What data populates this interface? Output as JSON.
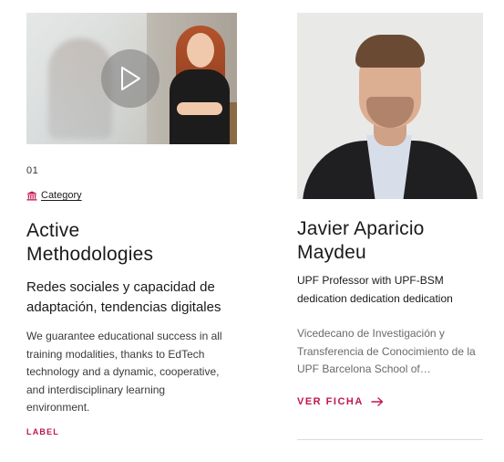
{
  "colors": {
    "accent": "#c0174a",
    "text": "#1a1a1a",
    "muted": "#6a6a6a"
  },
  "left_card": {
    "thumbnail_icon": "play-icon",
    "number": "01",
    "category_icon": "institution-icon",
    "category": "Category",
    "title_line1": "Active",
    "title_line2": "Methodologies",
    "subtitle": "Redes sociales y capacidad de adaptación, tendencias digitales",
    "description": "We guarantee educational success in all training modalities, thanks to EdTech technology and a dynamic, cooperative, and interdisciplinary learning environment.",
    "label": "LABEL"
  },
  "right_card": {
    "name_line1": "Javier Aparicio",
    "name_line2": "Maydeu",
    "role": "UPF Professor with UPF-BSM dedication dedication dedication",
    "description": "Vicedecano de Investigación y Transferencia de Conocimiento de la UPF Barcelona School of Management",
    "link_label": "VER FICHA",
    "link_icon": "arrow-right-icon"
  }
}
